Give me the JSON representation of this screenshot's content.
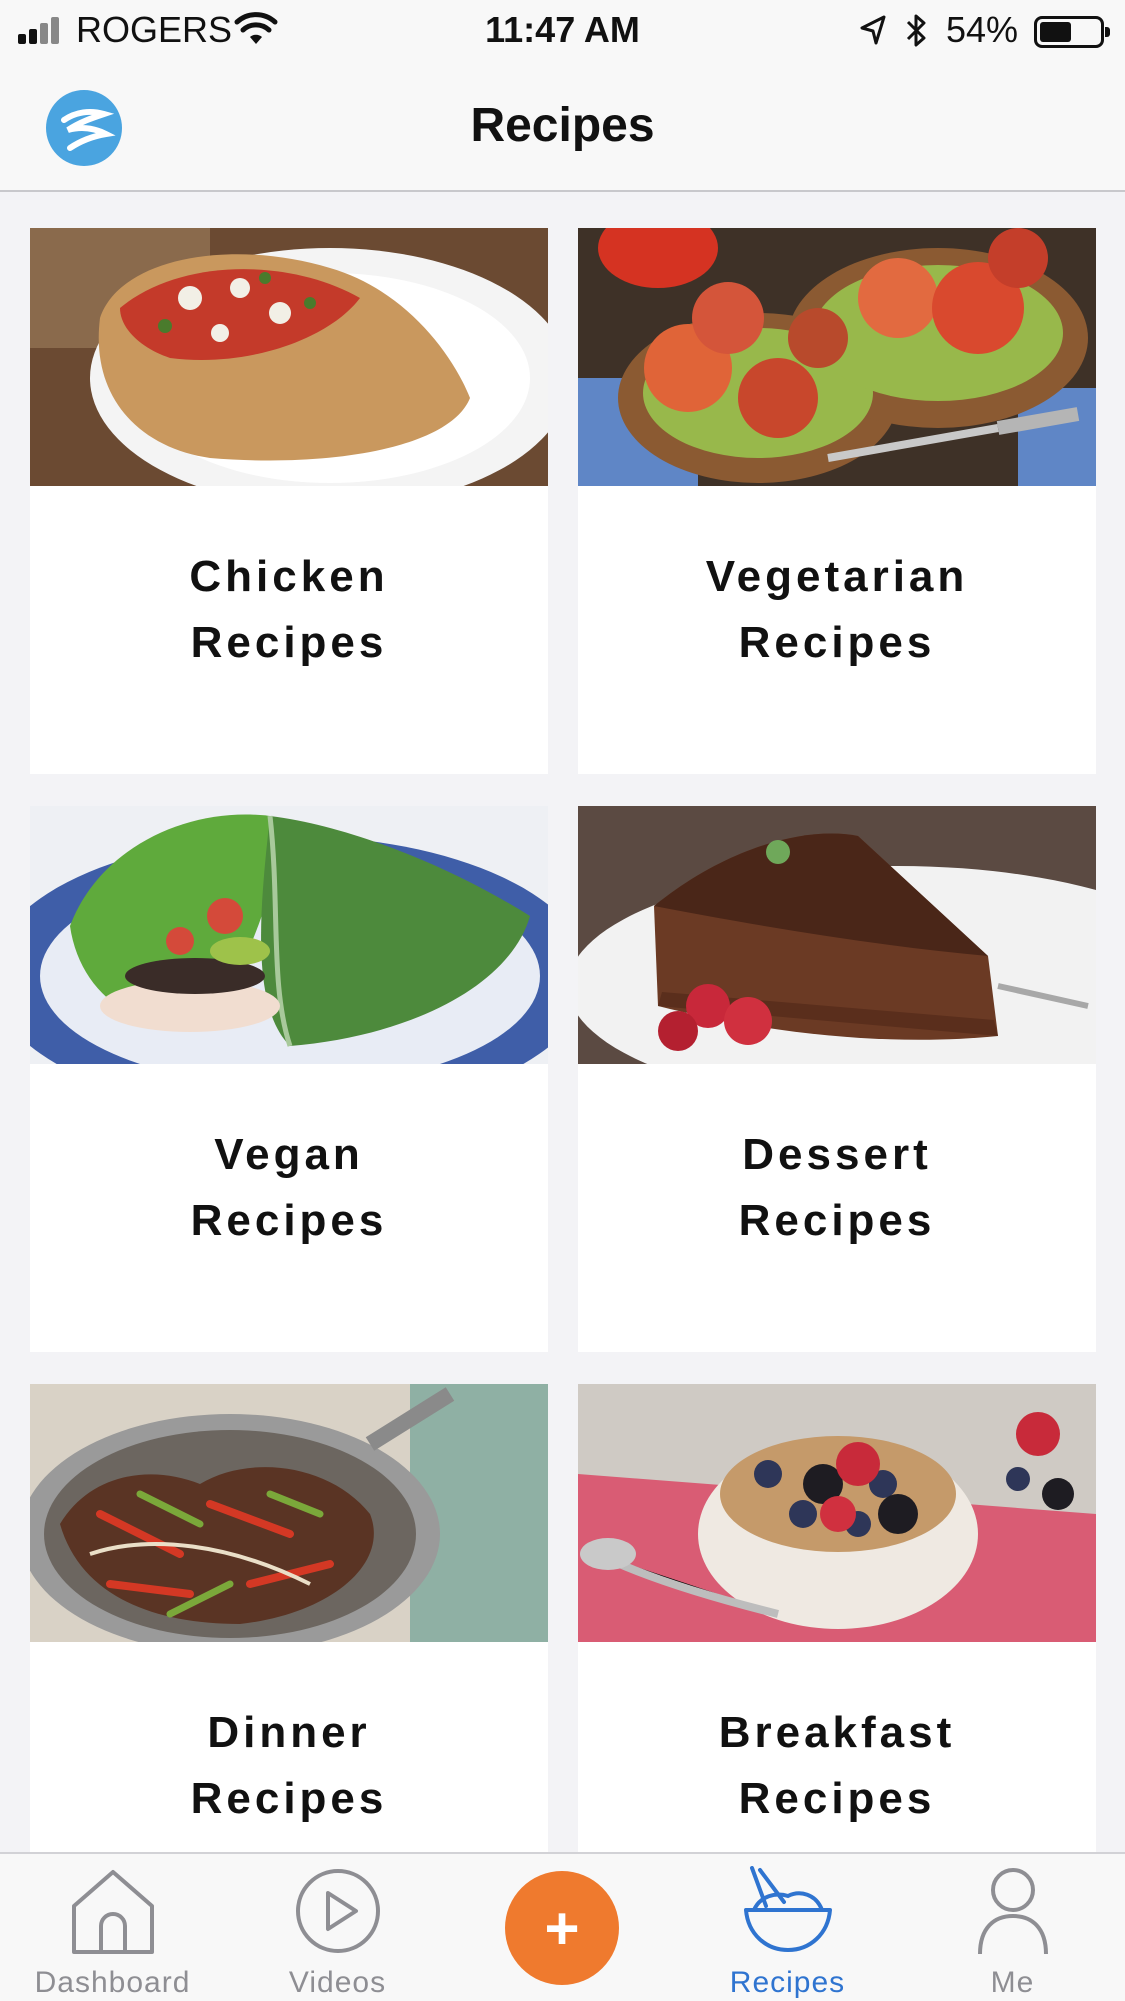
{
  "status_bar": {
    "carrier": "ROGERS",
    "time": "11:47 AM",
    "battery_percent": "54%",
    "battery_level": 0.54,
    "icons": [
      "signal-icon",
      "wifi-icon",
      "location-icon",
      "bluetooth-icon",
      "battery-icon"
    ]
  },
  "nav": {
    "title": "Recipes",
    "logo_icon": "app-logo-icon"
  },
  "categories": [
    {
      "line1": "Chicken",
      "line2": "Recipes",
      "image": "chicken-dish-photo"
    },
    {
      "line1": "Vegetarian",
      "line2": "Recipes",
      "image": "tomato-toast-photo"
    },
    {
      "line1": "Vegan",
      "line2": "Recipes",
      "image": "collard-wrap-photo"
    },
    {
      "line1": "Dessert",
      "line2": "Recipes",
      "image": "chocolate-cake-photo"
    },
    {
      "line1": "Dinner",
      "line2": "Recipes",
      "image": "steak-fajita-pan-photo"
    },
    {
      "line1": "Breakfast",
      "line2": "Recipes",
      "image": "oatmeal-berries-photo"
    }
  ],
  "tab_bar": {
    "tabs": [
      {
        "label": "Dashboard",
        "icon": "home-icon"
      },
      {
        "label": "Videos",
        "icon": "play-circle-icon"
      },
      {
        "label": "",
        "icon": "plus-icon"
      },
      {
        "label": "Recipes",
        "icon": "bowl-icon"
      },
      {
        "label": "Me",
        "icon": "person-icon"
      }
    ],
    "active": "Recipes",
    "add_symbol": "+"
  },
  "colors": {
    "accent": "#2f74d0",
    "add_button": "#ef7a2e",
    "logo": "#4aa4e0",
    "background": "#f3f3f6"
  }
}
